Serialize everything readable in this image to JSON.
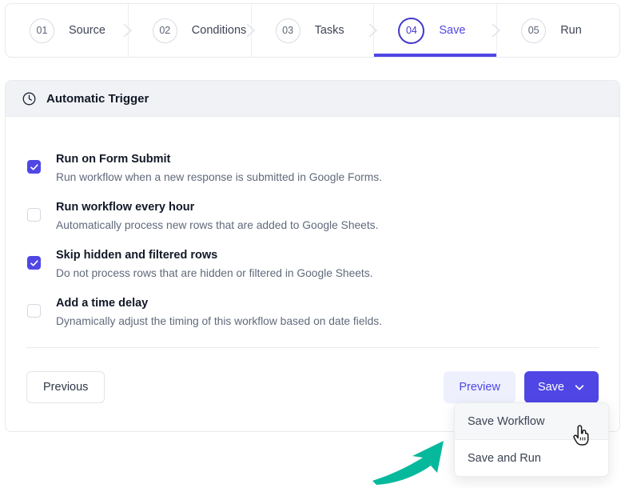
{
  "stepper": {
    "steps": [
      {
        "num": "01",
        "label": "Source",
        "active": false
      },
      {
        "num": "02",
        "label": "Conditions",
        "active": false
      },
      {
        "num": "03",
        "label": "Tasks",
        "active": false
      },
      {
        "num": "04",
        "label": "Save",
        "active": true
      },
      {
        "num": "05",
        "label": "Run",
        "active": false
      }
    ]
  },
  "card": {
    "header_icon": "clock-icon",
    "header_title": "Automatic Trigger",
    "options": [
      {
        "checked": true,
        "title": "Run on Form Submit",
        "desc": "Run workflow when a new response is submitted in Google Forms."
      },
      {
        "checked": false,
        "title": "Run workflow every hour",
        "desc": "Automatically process new rows that are added to Google Sheets."
      },
      {
        "checked": true,
        "title": "Skip hidden and filtered rows",
        "desc": "Do not process rows that are hidden or filtered in Google Sheets."
      },
      {
        "checked": false,
        "title": "Add a time delay",
        "desc": "Dynamically adjust the timing of this workflow based on date fields."
      }
    ]
  },
  "footer": {
    "previous_label": "Previous",
    "preview_label": "Preview",
    "save_label": "Save",
    "save_caret_icon": "chevron-down-icon"
  },
  "dropdown": {
    "items": [
      {
        "label": "Save Workflow",
        "hovered": true
      },
      {
        "label": "Save and Run",
        "hovered": false
      }
    ]
  },
  "annotation": {
    "arrow_icon": "arrow-up-right-annotation",
    "arrow_color": "#06b99c"
  },
  "cursor": {
    "icon": "pointing-hand-cursor"
  },
  "colors": {
    "accent": "#4f46e5",
    "accent_dark": "#4338ca",
    "accent_soft": "#eef0fe",
    "header_bg": "#f1f2f6",
    "border": "#e9eaee",
    "text": "#111827",
    "muted_text": "#606a7b",
    "annotation": "#06b99c"
  }
}
